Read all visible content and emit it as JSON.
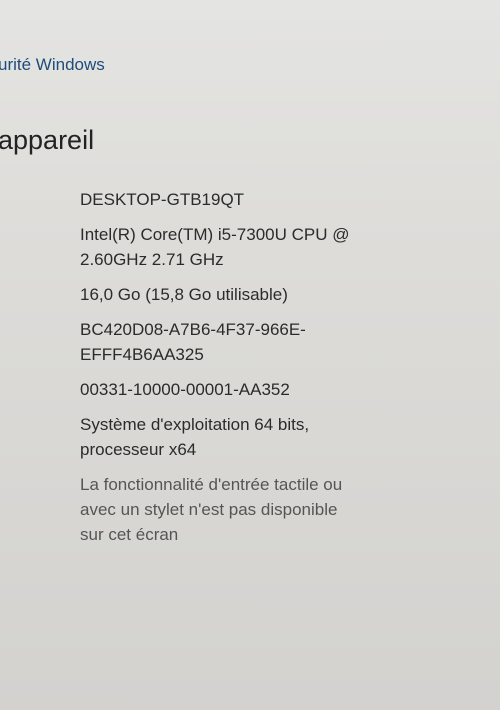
{
  "header": {
    "security_link": "urité Windows",
    "section_title": "appareil"
  },
  "specs": [
    {
      "id": "device-name",
      "value": "DESKTOP-GTB19QT"
    },
    {
      "id": "processor",
      "value": "Intel(R) Core(TM) i5-7300U CPU @\n2.60GHz   2.71 GHz"
    },
    {
      "id": "ram",
      "value": "16,0 Go (15,8 Go utilisable)"
    },
    {
      "id": "device-id",
      "value": "BC420D08-A7B6-4F37-966E-\nEFFF4B6AA325"
    },
    {
      "id": "product-id",
      "value": "00331-10000-00001-AA352"
    },
    {
      "id": "system-type",
      "value": "Système d'exploitation 64 bits,\nprocesseur x64"
    },
    {
      "id": "pen-touch",
      "value": "La fonctionnalité d'entrée tactile ou\navec un stylet n'est pas disponible\nsur cet écran"
    }
  ]
}
